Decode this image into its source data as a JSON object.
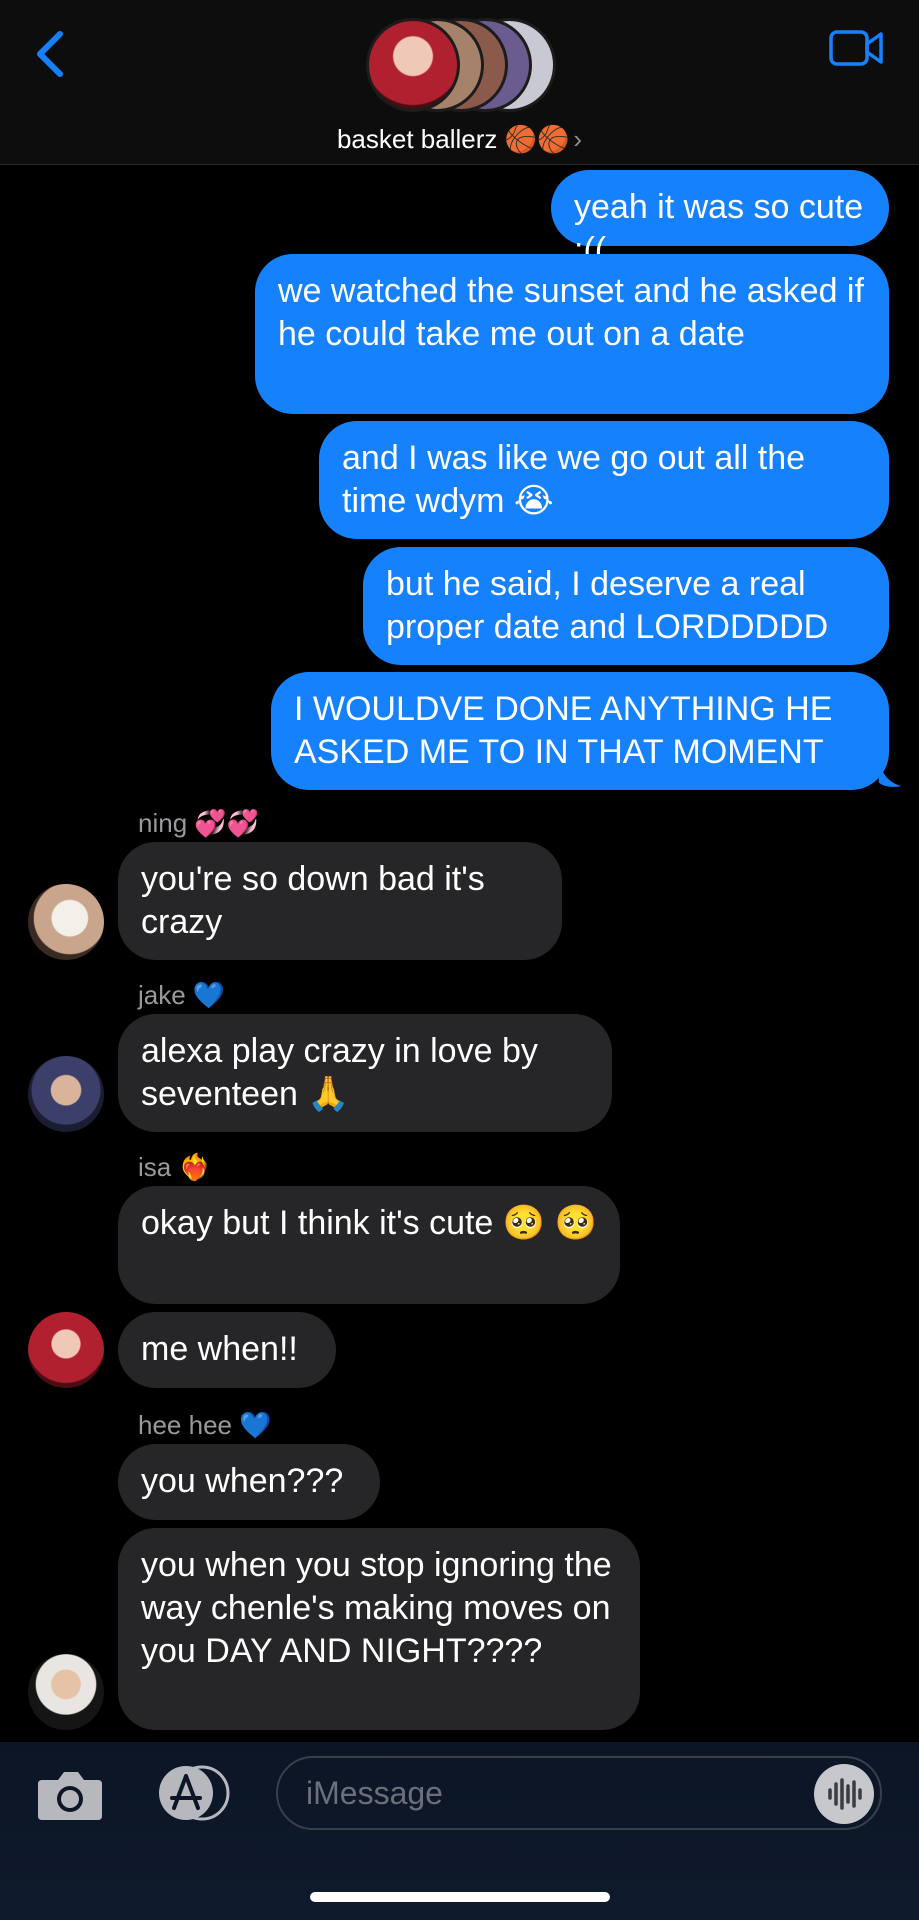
{
  "header": {
    "group_name": "basket ballerz 🏀🏀",
    "chevron": "›"
  },
  "messages": {
    "sent": [
      "yeah it was so cute :((",
      "we watched the sunset and he asked if he could take me out on a date",
      "and I was like we go out all the time wdym 😭",
      "but he said, I deserve a real proper date and LORDDDDD",
      "I WOULDVE DONE ANYTHING HE ASKED ME TO IN THAT MOMENT"
    ],
    "received": [
      {
        "sender": "ning 💞💞",
        "text": "you're so down bad it's crazy"
      },
      {
        "sender": "jake 💙",
        "text": "alexa play crazy in love by seventeen 🙏"
      },
      {
        "sender": "isa ❤️‍🔥",
        "text": "okay but I think it's cute 🥺 🥺"
      },
      {
        "sender": "",
        "text": "me when!!"
      },
      {
        "sender": "hee hee 💙",
        "text": "you when???"
      },
      {
        "sender": "",
        "text": "you when you stop ignoring the way chenle's making moves on you DAY AND NIGHT????"
      }
    ]
  },
  "composer": {
    "placeholder": "iMessage"
  },
  "icons": [
    "back-chevron-icon",
    "video-camera-icon",
    "camera-icon",
    "app-store-icon",
    "audio-wave-icon"
  ],
  "colors": {
    "accent": "#1681fd",
    "received_bubble": "#262628",
    "background": "#000000"
  }
}
